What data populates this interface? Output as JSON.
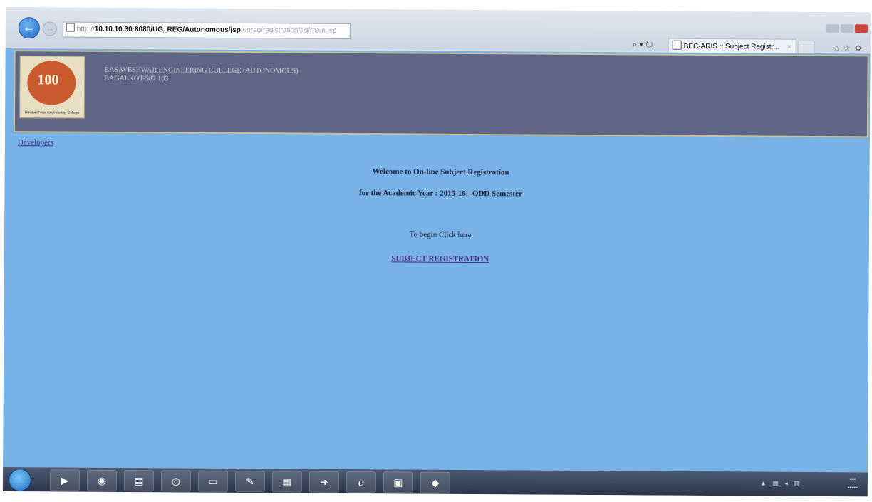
{
  "browser": {
    "address_proto": "http://",
    "address_host": "10.10.10.30:8080/UG_REG/Autonomous/jsp",
    "address_rest": "/ugreg/registrationfaq/main.jsp",
    "search_glyph": "⌕ ▾ ↻",
    "tab_title": "BEC-ARIS :: Subject Registr...",
    "tab_close": "×"
  },
  "header": {
    "college_name": "BASAVESHWAR ENGINEERING COLLEGE (AUTONOMOUS)",
    "college_city": "BAGALKOT-587 103",
    "logo_text": "100",
    "logo_caption": "Basaveshwar Engineering College"
  },
  "page": {
    "developers_link": "Developers",
    "welcome_line1": "Welcome to On-line Subject Registration",
    "welcome_line2": "for the Academic Year : 2015-16 - ODD Semester",
    "begin_text": "To begin Click here",
    "registration_link": "SUBJECT REGISTRATION"
  },
  "taskbar": {
    "apps": [
      {
        "name": "media-player-icon",
        "glyph": "▶"
      },
      {
        "name": "firefox-icon",
        "glyph": "◉"
      },
      {
        "name": "file-explorer-icon",
        "glyph": "▤"
      },
      {
        "name": "chrome-icon",
        "glyph": "◎"
      },
      {
        "name": "remote-desktop-icon",
        "glyph": "▭"
      },
      {
        "name": "paint-icon",
        "glyph": "✎"
      },
      {
        "name": "folder-icon",
        "glyph": "▦"
      },
      {
        "name": "arrow-app-icon",
        "glyph": "➜"
      },
      {
        "name": "internet-explorer-icon",
        "glyph": "ℯ"
      },
      {
        "name": "window-app-icon",
        "glyph": "▣"
      },
      {
        "name": "acrobat-icon",
        "glyph": "◆"
      }
    ]
  },
  "colors": {
    "page_bg": "#79b2e6",
    "banner_bg": "#5f6685",
    "link": "#4a2d7d"
  }
}
